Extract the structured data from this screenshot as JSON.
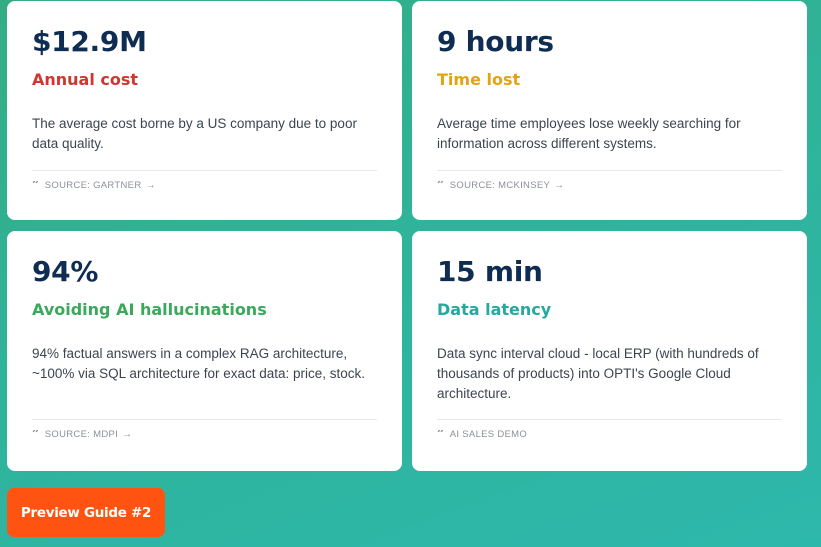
{
  "cards": [
    {
      "value": "$12.9M",
      "subtitle": "Annual cost",
      "subtitle_color": "#d0352f",
      "description": "The average cost borne by a US company due to poor data quality.",
      "source": "SOURCE: GARTNER",
      "source_has_link": true
    },
    {
      "value": "9 hours",
      "subtitle": "Time lost",
      "subtitle_color": "#e3a414",
      "description": "Average time employees lose weekly searching for information across different systems.",
      "source": "SOURCE: MCKINSEY",
      "source_has_link": true
    },
    {
      "value": "94%",
      "subtitle": "Avoiding AI hallucinations",
      "subtitle_color": "#3aa95c",
      "description": "94% factual answers in a complex RAG architecture, ~100% via SQL architecture for exact data: price, stock.",
      "source": "SOURCE: MDPI",
      "source_has_link": true
    },
    {
      "value": "15 min",
      "subtitle": "Data latency",
      "subtitle_color": "#24a8a0",
      "description": "Data sync interval cloud - local ERP (with hundreds of thousands of products) into OPTI's Google Cloud architecture.",
      "source": "AI SALES DEMO",
      "source_has_link": false
    }
  ],
  "quote_glyph": "”",
  "link_glyph": "→",
  "preview_button": {
    "label": "Preview Guide #2",
    "color": "#ff5312"
  },
  "colors": {
    "value_text": "#0f2d52",
    "background_start": "#34ad84",
    "background_end": "#2db8ac"
  }
}
